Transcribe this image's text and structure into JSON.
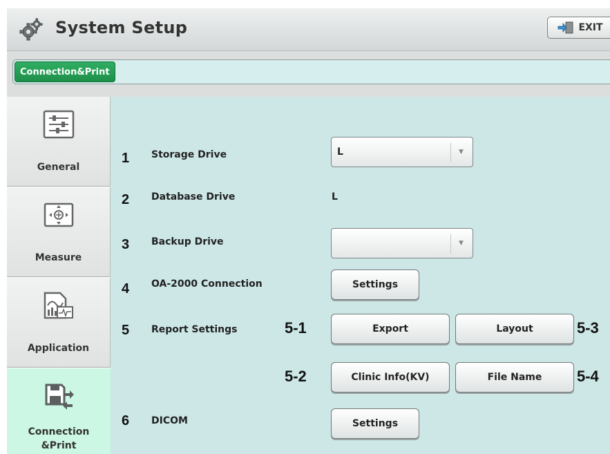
{
  "window": {
    "title": "System Setup",
    "exit_label": "EXIT"
  },
  "tabs": [
    {
      "label": "Connection&Print",
      "active": true
    }
  ],
  "sidebar": {
    "items": [
      {
        "label": "General",
        "icon": "sliders-panel-icon"
      },
      {
        "label": "Measure",
        "icon": "crosshair-target-icon"
      },
      {
        "label": "Application",
        "icon": "chart-document-icon"
      },
      {
        "label": "Connection\n&Print",
        "icon": "save-transfer-icon",
        "active": true
      }
    ]
  },
  "settings": {
    "storage_drive": {
      "num": "1",
      "label": "Storage Drive",
      "value": "L"
    },
    "database_drive": {
      "num": "2",
      "label": "Database Drive",
      "value": "L"
    },
    "backup_drive": {
      "num": "3",
      "label": "Backup Drive",
      "value": ""
    },
    "oa_connection": {
      "num": "4",
      "label": "OA-2000 Connection",
      "button": "Settings"
    },
    "report_settings": {
      "num": "5",
      "label": "Report Settings",
      "export": {
        "tag": "5-1",
        "label": "Export"
      },
      "clinic_info": {
        "tag": "5-2",
        "label": "Clinic Info(KV)"
      },
      "layout": {
        "tag": "5-3",
        "label": "Layout"
      },
      "file_name": {
        "tag": "5-4",
        "label": "File Name"
      }
    },
    "dicom": {
      "num": "6",
      "label": "DICOM",
      "button": "Settings"
    }
  },
  "colors": {
    "content_bg": "#cde7e7",
    "active_tab": "#1e8f4a",
    "active_sidebar": "#ccf7e4"
  }
}
